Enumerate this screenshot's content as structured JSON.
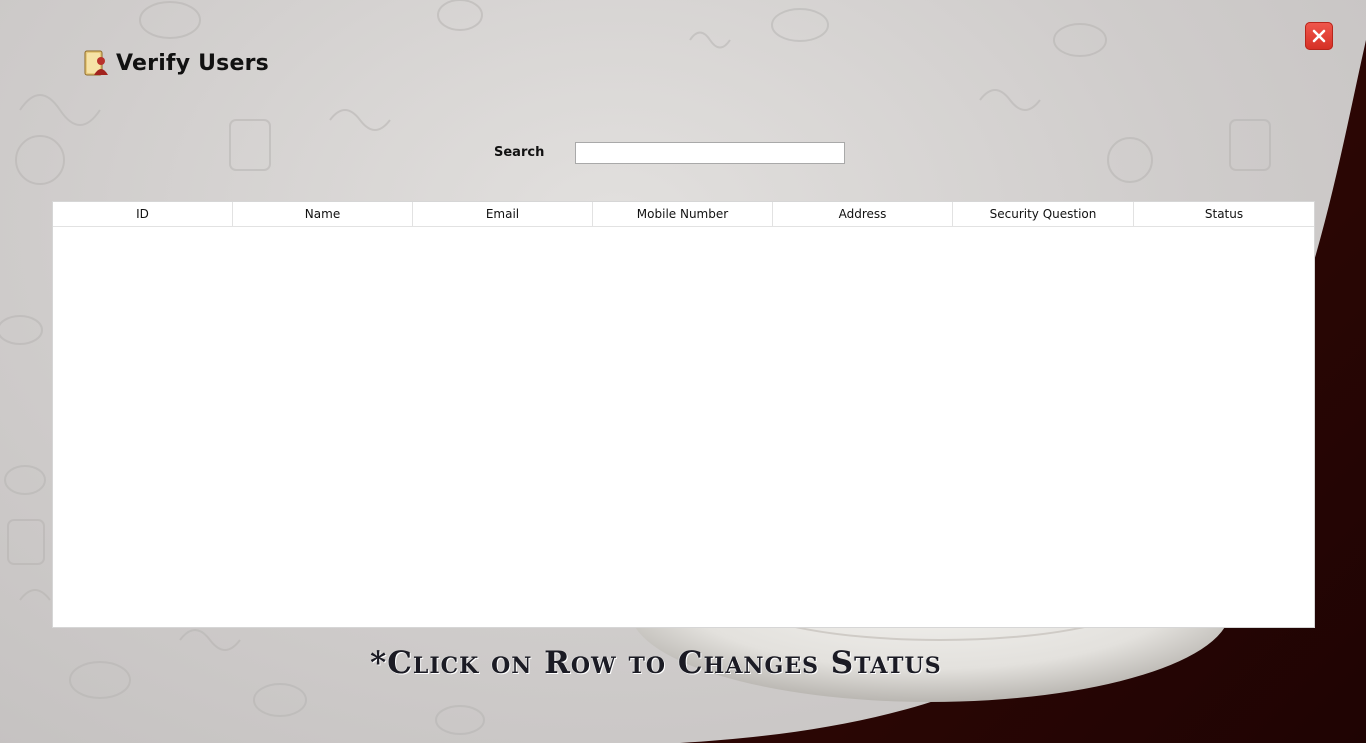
{
  "window": {
    "title": "Verify Users",
    "title_icon": "user-folder-icon",
    "close_icon": "close-icon",
    "accent_color": "#e0453a"
  },
  "search": {
    "label": "Search",
    "value": "",
    "placeholder": ""
  },
  "table": {
    "columns": [
      "ID",
      "Name",
      "Email",
      "Mobile Number",
      "Address",
      "Security Question",
      "Status"
    ],
    "rows": []
  },
  "hint": {
    "text": "*Click on Row to Changes Status"
  }
}
